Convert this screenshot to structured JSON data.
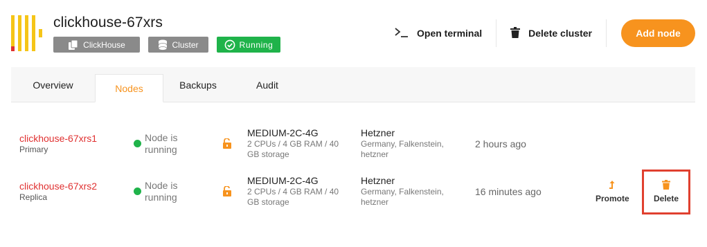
{
  "header": {
    "title": "clickhouse-67xrs",
    "tags": [
      {
        "label": "ClickHouse",
        "icon": "copy-icon"
      },
      {
        "label": "Cluster",
        "icon": "database-icon"
      },
      {
        "label": "Running",
        "icon": "check-circle-icon"
      }
    ],
    "actions": {
      "open_terminal": "Open terminal",
      "delete_cluster": "Delete cluster",
      "add_node": "Add node"
    }
  },
  "tabs": [
    "Overview",
    "Nodes",
    "Backups",
    "Audit"
  ],
  "active_tab": "Nodes",
  "nodes": [
    {
      "name": "clickhouse-67xrs1",
      "role": "Primary",
      "status": "Node is running",
      "size": "MEDIUM-2C-4G",
      "spec": "2 CPUs / 4 GB RAM / 40 GB storage",
      "provider": "Hetzner",
      "location": "Germany, Falkenstein, hetzner",
      "created": "2 hours ago"
    },
    {
      "name": "clickhouse-67xrs2",
      "role": "Replica",
      "status": "Node is running",
      "size": "MEDIUM-2C-4G",
      "spec": "2 CPUs / 4 GB RAM / 40 GB storage",
      "provider": "Hetzner",
      "location": "Germany, Falkenstein, hetzner",
      "created": "16 minutes ago",
      "promote_label": "Promote",
      "delete_label": "Delete"
    }
  ],
  "colors": {
    "accent": "#f7931e",
    "node_name": "#e03131",
    "running": "#1fb34a",
    "tag_gray": "#8a8a8a"
  }
}
